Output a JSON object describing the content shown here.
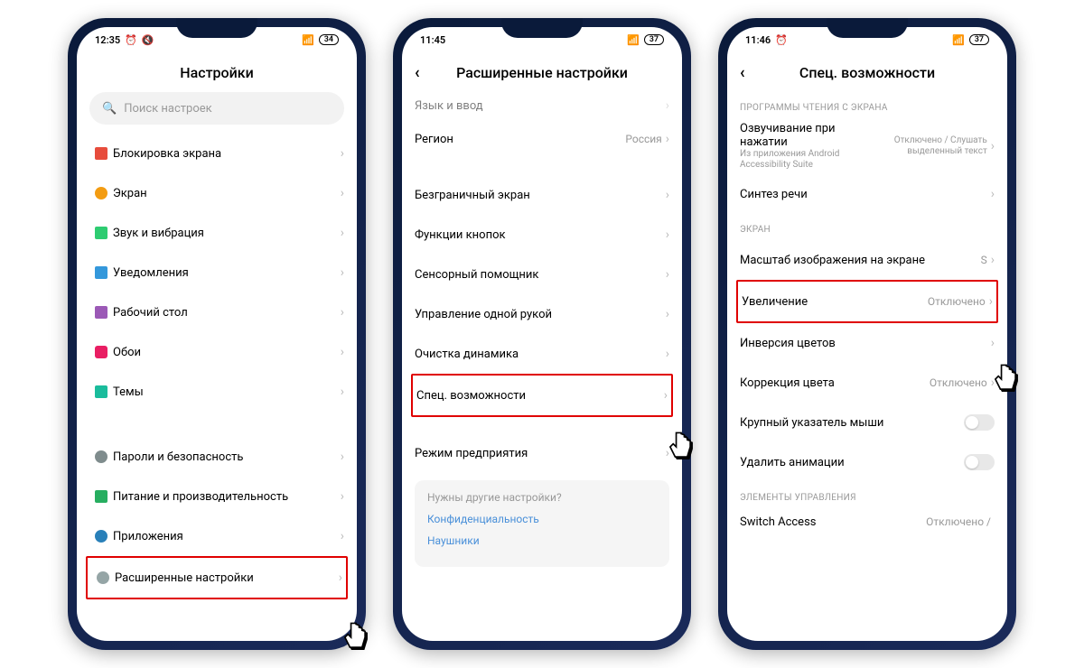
{
  "phone1": {
    "status": {
      "time": "12:35",
      "battery": "34"
    },
    "title": "Настройки",
    "search_placeholder": "Поиск настроек",
    "group1": [
      {
        "icon": "ico-lock",
        "label": "Блокировка экрана"
      },
      {
        "icon": "ico-sun",
        "label": "Экран"
      },
      {
        "icon": "ico-sound",
        "label": "Звук и вибрация"
      },
      {
        "icon": "ico-bell",
        "label": "Уведомления"
      },
      {
        "icon": "ico-home",
        "label": "Рабочий стол"
      },
      {
        "icon": "ico-flower",
        "label": "Обои"
      },
      {
        "icon": "ico-theme",
        "label": "Темы"
      }
    ],
    "group2": [
      {
        "icon": "ico-shield",
        "label": "Пароли и безопасность"
      },
      {
        "icon": "ico-battery",
        "label": "Питание и производительность"
      },
      {
        "icon": "ico-apps",
        "label": "Приложения"
      }
    ],
    "highlighted": {
      "icon": "ico-more",
      "label": "Расширенные настройки"
    }
  },
  "phone2": {
    "status": {
      "time": "11:45",
      "battery": "37"
    },
    "title": "Расширенные настройки",
    "top_row": {
      "label": "Язык и ввод"
    },
    "region": {
      "label": "Регион",
      "value": "Россия"
    },
    "group1": [
      {
        "label": "Безграничный экран"
      },
      {
        "label": "Функции кнопок"
      },
      {
        "label": "Сенсорный помощник"
      },
      {
        "label": "Управление одной рукой"
      },
      {
        "label": "Очистка динамика"
      }
    ],
    "highlighted": {
      "label": "Спец. возможности"
    },
    "after": {
      "label": "Режим предприятия"
    },
    "card": {
      "question": "Нужны другие настройки?",
      "links": [
        "Конфиденциальность",
        "Наушники"
      ]
    }
  },
  "phone3": {
    "status": {
      "time": "11:46",
      "battery": "37"
    },
    "title": "Спец. возможности",
    "section1_header": "ПРОГРАММЫ ЧТЕНИЯ С ЭКРАНА",
    "talkback": {
      "title": "Озвучивание при нажатии",
      "sub": "Из приложения Android Accessibility Suite",
      "value": "Отключено / Слушать выделенный текст"
    },
    "tts": {
      "label": "Синтез речи"
    },
    "section2_header": "ЭКРАН",
    "display_scale": {
      "label": "Масштаб изображения на экране",
      "value": "S"
    },
    "highlighted": {
      "label": "Увеличение",
      "value": "Отключено"
    },
    "after": [
      {
        "label": "Инверсия цветов"
      },
      {
        "label": "Коррекция цвета",
        "value": "Отключено"
      }
    ],
    "toggles": [
      {
        "label": "Крупный указатель мыши"
      },
      {
        "label": "Удалить анимации"
      }
    ],
    "section3_header": "ЭЛЕМЕНТЫ УПРАВЛЕНИЯ",
    "switch_access": {
      "label": "Switch Access",
      "value": "Отключено /"
    }
  }
}
